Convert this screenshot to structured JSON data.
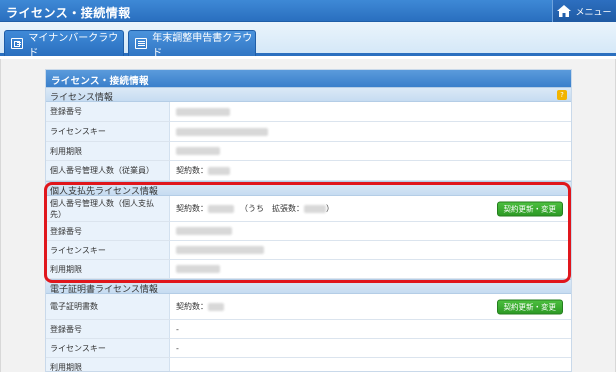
{
  "window": {
    "title": "ライセンス・接続情報",
    "menu_label": "メニュー"
  },
  "tabs": [
    {
      "label": "マイナンバークラウド",
      "icon": "id-card-icon"
    },
    {
      "label": "年末調整申告書クラウド",
      "icon": "document-icon"
    }
  ],
  "panel": {
    "title": "ライセンス・接続情報",
    "license": {
      "header": "ライセンス情報",
      "help_icon": "?",
      "rows": [
        {
          "label": "登録番号",
          "value": ""
        },
        {
          "label": "ライセンスキー",
          "value": ""
        },
        {
          "label": "利用期限",
          "value": ""
        },
        {
          "label": "個人番号管理人数（従業員）",
          "value": "契約数："
        }
      ]
    },
    "payee": {
      "header": "個人支払先ライセンス情報",
      "rows": [
        {
          "label": "個人番号管理人数（個人支払先）",
          "value_prefix": "契約数：",
          "value_mid": "（うち　拡張数：",
          "value_suffix": "）",
          "button": "契約更新・変更"
        },
        {
          "label": "登録番号",
          "value": ""
        },
        {
          "label": "ライセンスキー",
          "value": ""
        },
        {
          "label": "利用期限",
          "value": ""
        }
      ]
    },
    "cert": {
      "header": "電子証明書ライセンス情報",
      "rows": [
        {
          "label": "電子証明書数",
          "value": "契約数：",
          "button": "契約更新・変更"
        },
        {
          "label": "登録番号",
          "value": "-"
        },
        {
          "label": "ライセンスキー",
          "value": "-"
        },
        {
          "label": "利用期限",
          "value": ""
        }
      ]
    }
  }
}
